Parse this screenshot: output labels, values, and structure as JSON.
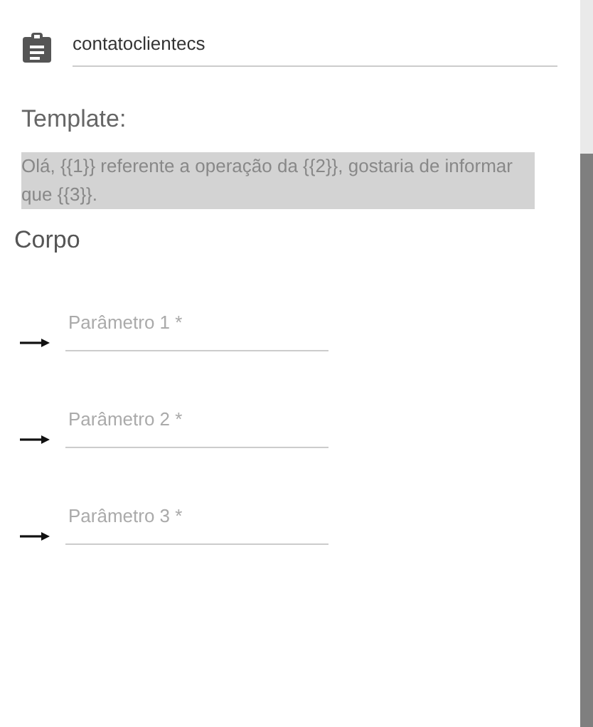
{
  "name_field": {
    "value": "contatoclientecs"
  },
  "template": {
    "label": "Template:",
    "text": "Olá, {{1}} referente a operação da {{2}}, gostaria de informar que {{3}}."
  },
  "body": {
    "label": "Corpo",
    "parameters": [
      {
        "placeholder": "Parâmetro 1 *"
      },
      {
        "placeholder": "Parâmetro 2 *"
      },
      {
        "placeholder": "Parâmetro 3 *"
      }
    ]
  }
}
